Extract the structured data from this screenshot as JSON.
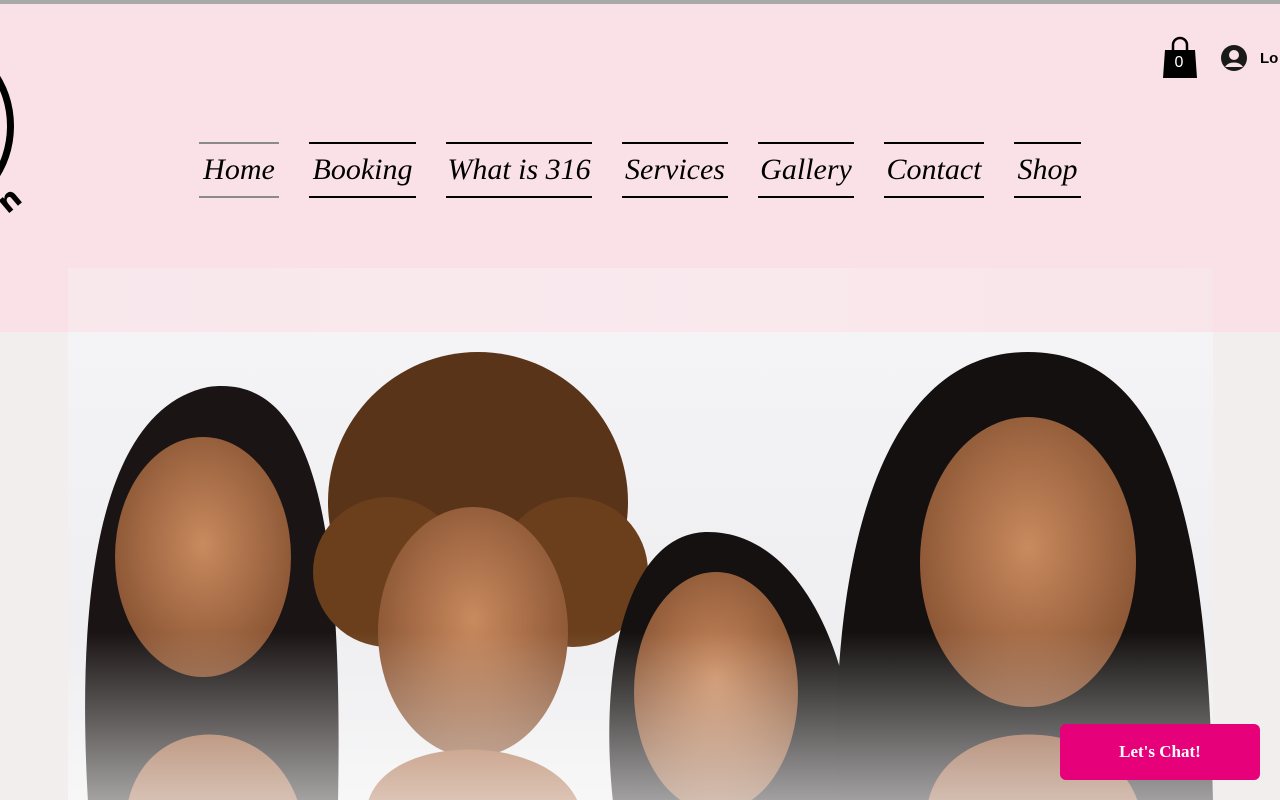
{
  "header": {
    "logo_text": "n",
    "cart_count": "0",
    "login_label": "Lo"
  },
  "nav": {
    "items": [
      {
        "label": "Home",
        "active": true
      },
      {
        "label": "Booking"
      },
      {
        "label": "What is 316"
      },
      {
        "label": "Services"
      },
      {
        "label": "Gallery"
      },
      {
        "label": "Contact"
      },
      {
        "label": "Shop"
      }
    ]
  },
  "hero": {
    "image_icon": "group-portrait-photo"
  },
  "chat": {
    "label": "Let's Chat!"
  },
  "colors": {
    "header_bg": "#fae1e7",
    "page_bg": "#f1eeed",
    "chat_button": "#e6007a"
  }
}
